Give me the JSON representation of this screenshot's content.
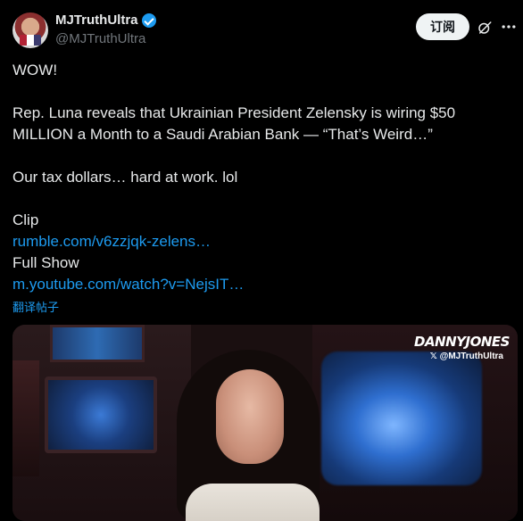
{
  "author": {
    "display_name": "MJTruthUltra",
    "handle": "@MJTruthUltra",
    "verified_icon": "verified-badge-icon"
  },
  "actions": {
    "subscribe_label": "订阅",
    "grok_icon": "grok-icon",
    "more_icon": "more-icon"
  },
  "post": {
    "line1": "WOW!",
    "line2": "Rep. Luna reveals that Ukrainian President Zelensky is wiring $50 MILLION a Month to a Saudi Arabian Bank — “That’s Weird…”",
    "line3": "Our tax dollars… hard at work. lol",
    "clip_label": "Clip",
    "clip_link": "rumble.com/v6zzjqk-zelens…",
    "full_show_label": "Full Show",
    "full_show_link": "m.youtube.com/watch?v=NejsIT…",
    "translate_label": "翻译帖子"
  },
  "media": {
    "watermark_logo": "DANNYJONES",
    "watermark_handle": "𝕏 @MJTruthUltra"
  },
  "colors": {
    "background": "#000000",
    "text": "#e7e9ea",
    "muted": "#71767b",
    "link": "#1d9bf0",
    "button_bg": "#eff3f4"
  }
}
